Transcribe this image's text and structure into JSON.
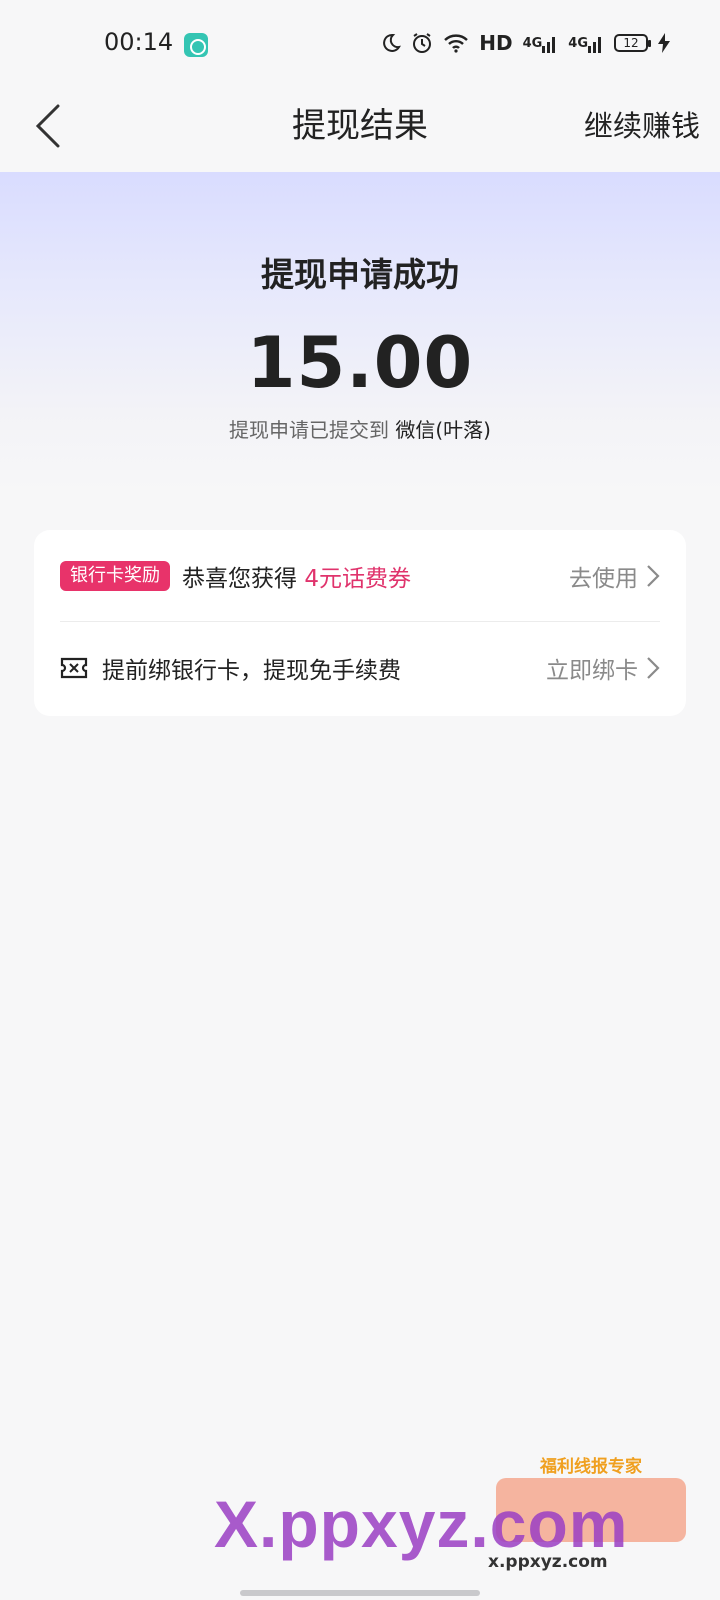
{
  "status_bar": {
    "time": "00:14",
    "hd_label": "HD",
    "net_label_1": "4G",
    "net_label_2": "4G",
    "battery": "12"
  },
  "header": {
    "title": "提现结果",
    "action": "继续赚钱"
  },
  "result": {
    "title": "提现申请成功",
    "amount": "15.00",
    "subtitle_prefix": "提现申请已提交到 ",
    "destination": "微信(叶落)"
  },
  "card": {
    "reward": {
      "badge": "银行卡奖励",
      "text": "恭喜您获得 ",
      "highlight": "4元话费券",
      "action": "去使用"
    },
    "bind": {
      "text": "提前绑银行卡，提现免手续费",
      "action": "立即绑卡"
    }
  },
  "watermark": {
    "logo_text": "X.ppxyz.com",
    "caption": "福利线报专家",
    "url": "x.ppxyz.com"
  },
  "colors": {
    "accent_pink": "#e8336a",
    "hero_top": "#d9dcff",
    "background": "#f7f7f8"
  }
}
